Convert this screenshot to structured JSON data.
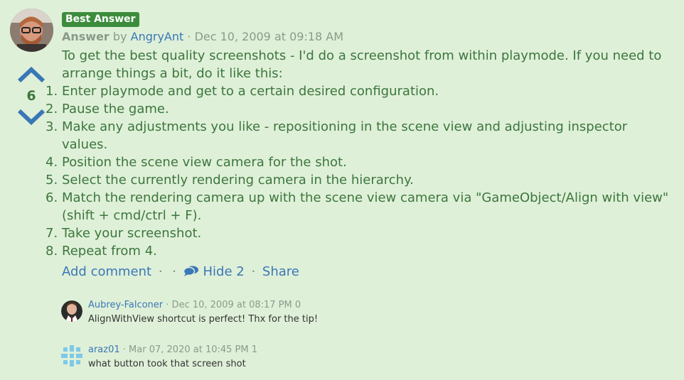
{
  "answer": {
    "badge": "Best Answer",
    "label": "Answer",
    "by": "by",
    "author": "AngryAnt",
    "date": "· Dec 10, 2009 at 09:18 AM",
    "votes": "6",
    "intro": "To get the best quality screenshots - I'd do a screenshot from within playmode. If you need to arrange things a bit, do it like this:",
    "steps": [
      {
        "num": "1.",
        "text": "Enter playmode and get to a certain desired configuration."
      },
      {
        "num": "2.",
        "text": "Pause the game."
      },
      {
        "num": "3.",
        "text": "Make any adjustments you like - repositioning in the scene view and adjusting inspector values."
      },
      {
        "num": "4.",
        "text": "Position the scene view camera for the shot."
      },
      {
        "num": "5.",
        "text": "Select the currently rendering camera in the hierarchy."
      },
      {
        "num": "6.",
        "text": "Match the rendering camera up with the scene view camera via \"GameObject/Align with view\" (shift + cmd/ctrl + F)."
      },
      {
        "num": "7.",
        "text": "Take your screenshot."
      },
      {
        "num": "8.",
        "text": "Repeat from 4."
      }
    ]
  },
  "actions": {
    "add_comment": "Add comment",
    "hide": "Hide 2",
    "share": "Share",
    "separator": "·"
  },
  "comments": [
    {
      "author": "Aubrey-Falconer",
      "date": "· Dec 10, 2009 at 08:17 PM",
      "votes": "0",
      "text": "AlignWithView shortcut is perfect! Thx for the tip!"
    },
    {
      "author": "araz01",
      "date": "· Mar 07, 2020 at 10:45 PM",
      "votes": "1",
      "text": "what button took that screen shot"
    }
  ],
  "icons": {
    "vote_up": "chevron-up-icon",
    "vote_down": "chevron-down-icon",
    "comments": "comments-icon"
  },
  "colors": {
    "background": "#dff0d8",
    "text": "#3c763d",
    "link": "#3a77b6",
    "badge": "#3c8c3c"
  }
}
